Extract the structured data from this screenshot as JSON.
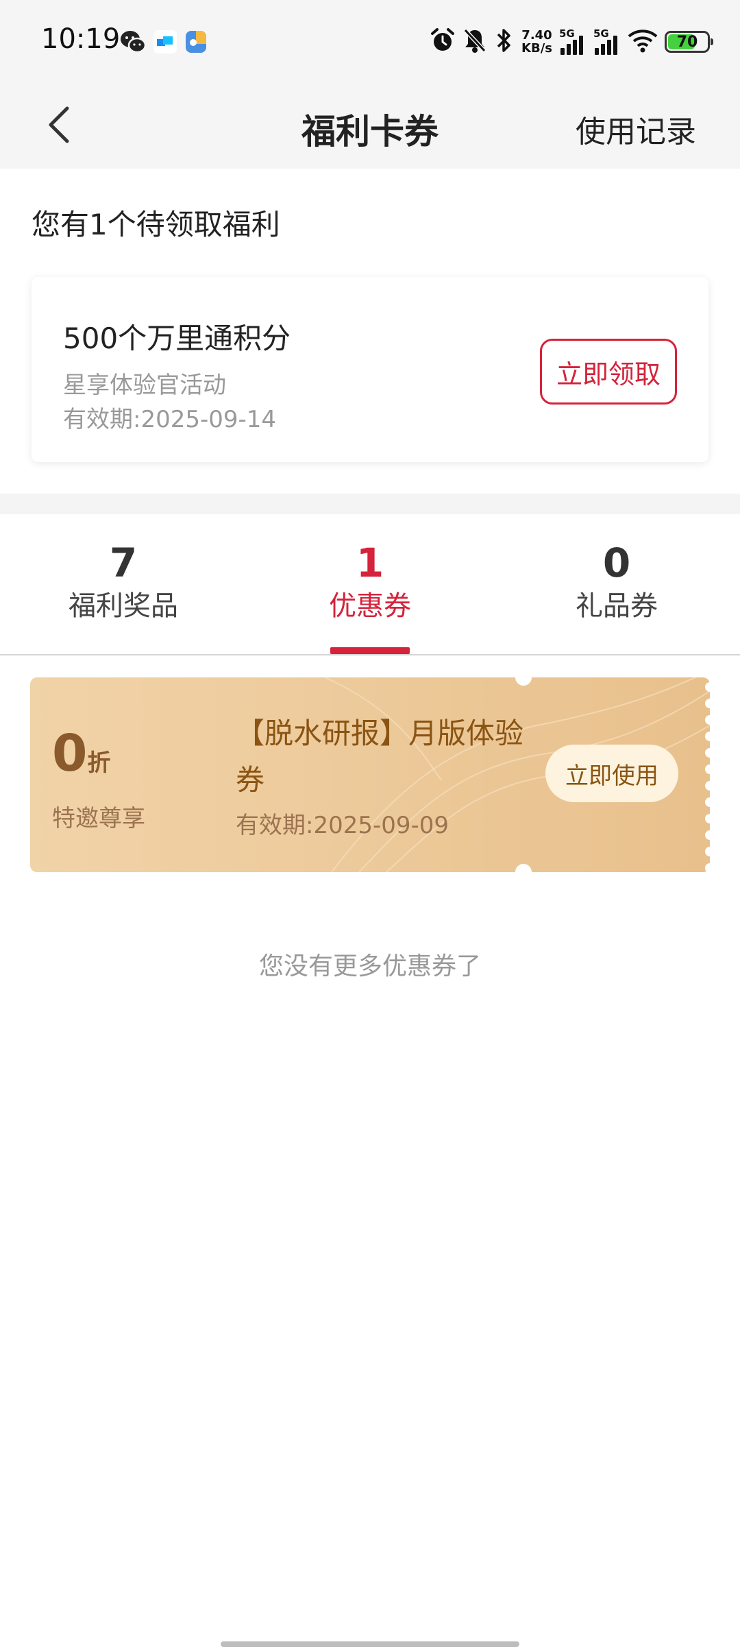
{
  "status_bar": {
    "time": "10:19",
    "speed_value": "7.40",
    "speed_unit": "KB/s",
    "signal1_label": "5G",
    "signal2_label": "5G",
    "battery": "70",
    "battery_level_percent": 70,
    "battery_fill_color": "#44d13d",
    "icons": [
      "wechat-icon",
      "app-icon-blue",
      "app-icon-multicolor",
      "alarm-icon",
      "mute-icon",
      "bluetooth-icon",
      "signal-icon",
      "wifi-icon",
      "battery-icon"
    ]
  },
  "nav": {
    "back_icon": "back-arrow-icon",
    "title": "福利卡券",
    "right_link": "使用记录"
  },
  "pending": {
    "header": "您有1个待领取福利",
    "card": {
      "title": "500个万里通积分",
      "subtitle": "星享体验官活动",
      "validity": "有效期:2025-09-14",
      "button": "立即领取"
    }
  },
  "tabs": [
    {
      "count": "7",
      "label": "福利奖品",
      "active": false
    },
    {
      "count": "1",
      "label": "优惠券",
      "active": true
    },
    {
      "count": "0",
      "label": "礼品券",
      "active": false
    }
  ],
  "coupon": {
    "discount_value": "0",
    "discount_unit": "折",
    "tag": "特邀尊享",
    "title": "【脱水研报】月版体验券",
    "validity": "有效期:2025-09-09",
    "button": "立即使用"
  },
  "footer_note": "您没有更多优惠券了",
  "colors": {
    "accent_red": "#d4233b",
    "coupon_gold_light": "#f0cfa0",
    "coupon_gold_dark": "#e6bd86",
    "coupon_text": "#8a5412"
  }
}
